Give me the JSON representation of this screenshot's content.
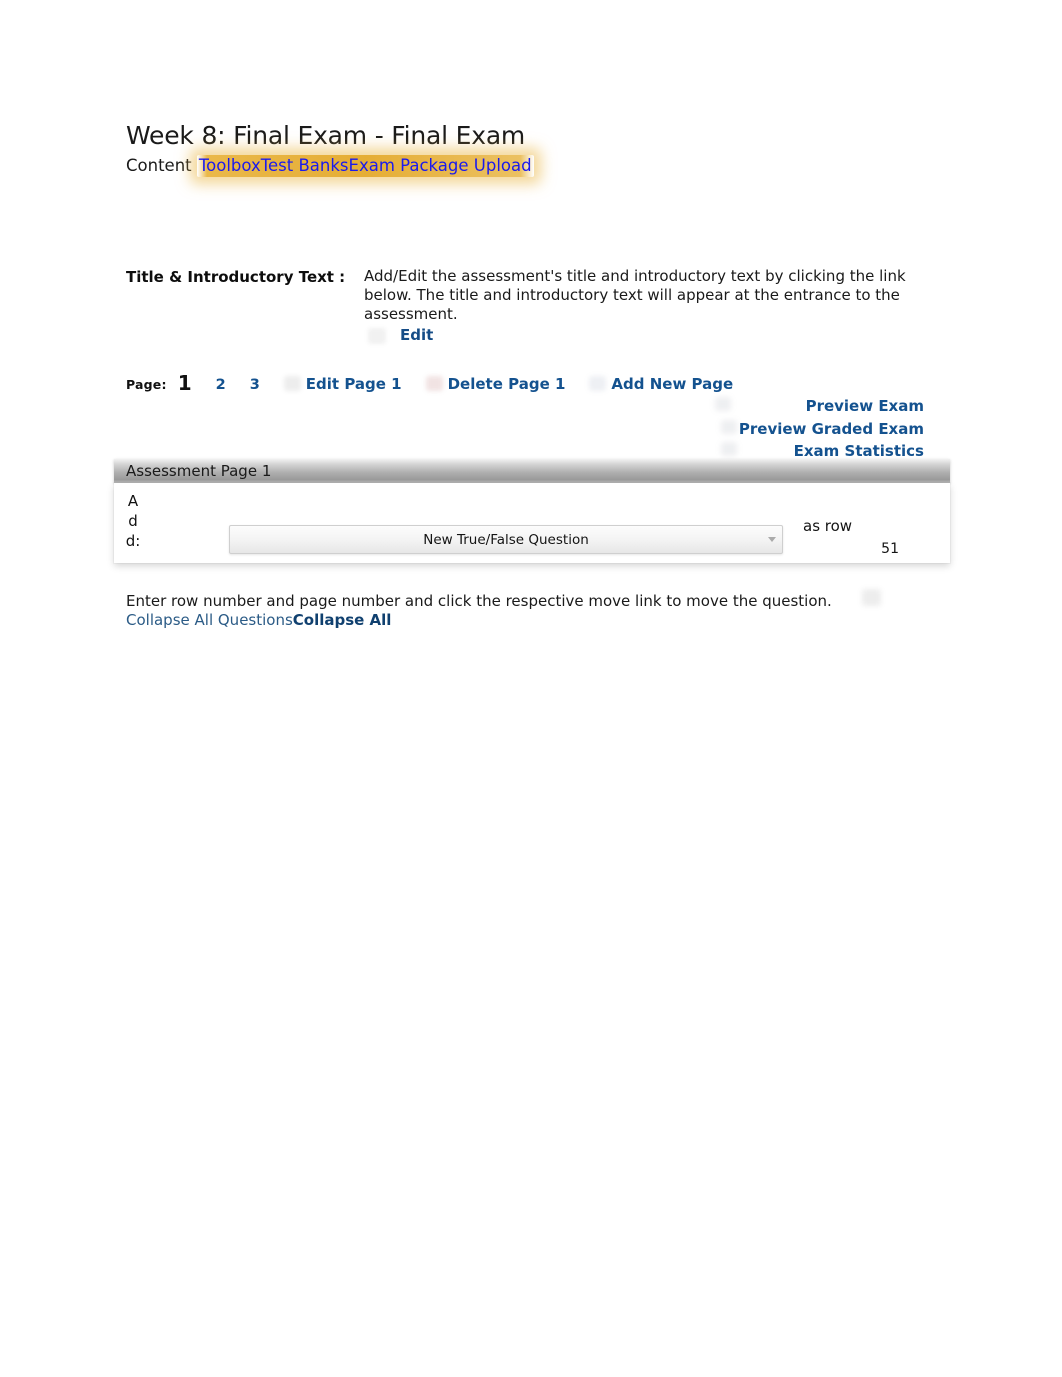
{
  "document": {
    "title": "Week 8: Final Exam - Final Exam"
  },
  "breadcrumb": {
    "static_label": "Content ",
    "links": [
      {
        "label": "Toolbox"
      },
      {
        "label": "Test Banks"
      },
      {
        "label": "Exam Package Upload"
      }
    ],
    "highlight_color": "#e4aa2d",
    "link_color": "#1a1aee"
  },
  "intro_section": {
    "label": "Title & Introductory Text :",
    "description": "Add/Edit the assessment's title and introductory text by clicking the link below. The title and introductory text will appear at the entrance to the assessment.",
    "edit_link": "Edit"
  },
  "page_nav": {
    "label": "Page:",
    "current_page": "1",
    "page_links": [
      {
        "label": "2"
      },
      {
        "label": "3"
      }
    ],
    "actions": [
      {
        "label": "Edit Page 1"
      },
      {
        "label": "Delete Page 1"
      },
      {
        "label": "Add New Page"
      }
    ]
  },
  "right_links": [
    {
      "label": "Preview Exam"
    },
    {
      "label": "Preview Graded Exam"
    },
    {
      "label": "Exam Statistics"
    }
  ],
  "assessment": {
    "section_title": "Assessment Page 1",
    "add_label": "Add:",
    "question_type_select": {
      "selected": "New True/False Question"
    },
    "as_row_label": "as row",
    "row_number_value": "51"
  },
  "footer": {
    "note": "Enter row number and page number and click the respective move link to move the question.",
    "collapse_all_questions": "Collapse All Questions",
    "collapse_all": "Collapse All"
  },
  "colors": {
    "link_blue": "#14528f",
    "breadcrumb_blue": "#1a1aee",
    "highlight_gold": "#e4aa2d",
    "text_black": "#1a1a1a"
  }
}
